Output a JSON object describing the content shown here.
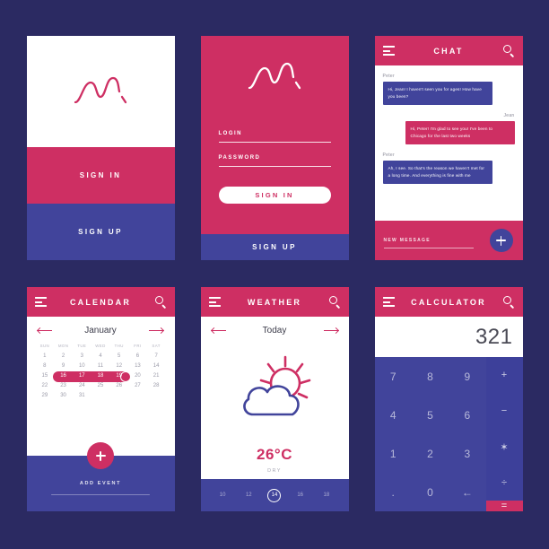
{
  "palette": {
    "background": "#2b2a62",
    "pink": "#ce2f63",
    "blue": "#41449b",
    "white": "#ffffff",
    "muted_text": "#9a9aa8"
  },
  "icons": {
    "hamburger": "hamburger-menu-icon",
    "search": "search-icon",
    "arrow_left": "arrow-left-icon",
    "arrow_right": "arrow-right-icon",
    "plus": "plus-icon",
    "logo": "mountain-logo-icon",
    "weather": "sun-behind-cloud-icon"
  },
  "splash": {
    "sign_in_label": "SIGN IN",
    "sign_up_label": "SIGN UP"
  },
  "login": {
    "login_label": "LOGIN",
    "login_value": "",
    "password_label": "PASSWORD",
    "password_value": "",
    "sign_in_label": "SIGN IN",
    "sign_up_label": "SIGN UP"
  },
  "chat": {
    "title": "CHAT",
    "messages": [
      {
        "sender": "Peter",
        "side": "left",
        "text": "Hi, Jean! I haven't seen you for ages! How have you been?"
      },
      {
        "sender": "Jean",
        "side": "right",
        "text": "Hi, Peter! I'm glad to see you! I've been to Chicago for the last two weeks"
      },
      {
        "sender": "Peter",
        "side": "left",
        "text": "Ah, I see. So that's the reason we haven't met for a long time. And everything is fine with me"
      }
    ],
    "compose_label": "NEW MESSAGE",
    "compose_value": ""
  },
  "calendar": {
    "title": "CALENDAR",
    "month": "January",
    "weekdays": [
      "SUN",
      "MON",
      "TUE",
      "WED",
      "THU",
      "FRI",
      "SAT"
    ],
    "weeks": [
      [
        "1",
        "2",
        "3",
        "4",
        "5",
        "6",
        "7"
      ],
      [
        "8",
        "9",
        "10",
        "11",
        "12",
        "13",
        "14"
      ],
      [
        "15",
        "16",
        "17",
        "18",
        "19",
        "20",
        "21"
      ],
      [
        "22",
        "23",
        "24",
        "25",
        "26",
        "27",
        "28"
      ],
      [
        "29",
        "30",
        "31",
        "",
        "",
        "",
        ""
      ]
    ],
    "selected_range": [
      "16",
      "17",
      "18",
      "19"
    ],
    "today": "19",
    "add_event_label": "ADD EVENT"
  },
  "weather": {
    "title": "WEATHER",
    "day": "Today",
    "temperature": "26°C",
    "condition": "DRY",
    "hours": [
      "10",
      "12",
      "14",
      "16",
      "18"
    ],
    "current_hour": "14"
  },
  "calculator": {
    "title": "CALCULATOR",
    "display": "321",
    "keys": [
      "7",
      "8",
      "9",
      "4",
      "5",
      "6",
      "1",
      "2",
      "3",
      ".",
      "0",
      "←"
    ],
    "operators": [
      "+",
      "−",
      "✶",
      "÷",
      "="
    ]
  }
}
